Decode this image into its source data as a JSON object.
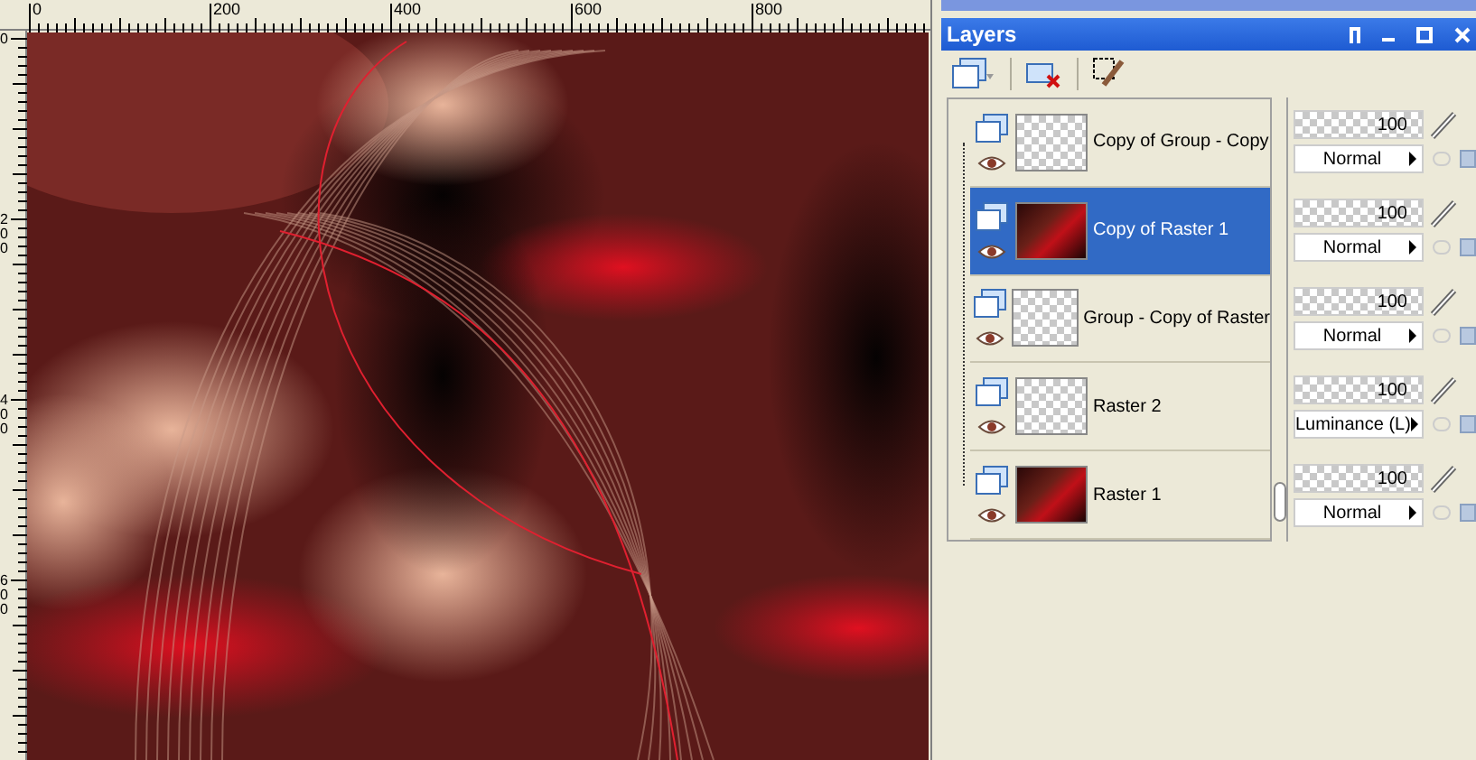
{
  "rulers": {
    "horizontal": [
      "0",
      "200",
      "400",
      "600",
      "800"
    ],
    "vertical": [
      "0",
      "200",
      "400",
      "600"
    ]
  },
  "layers_panel": {
    "title": "Layers",
    "layers": [
      {
        "name": "Copy of Group - Copy",
        "selected": false,
        "kind": "transparent",
        "opacity": "100",
        "level": 1,
        "blend_mode": "Normal"
      },
      {
        "name": "Copy of Raster 1",
        "selected": true,
        "kind": "dark",
        "opacity": "100",
        "level": 1,
        "blend_mode": "Normal"
      },
      {
        "name": "Group - Copy of Raster",
        "selected": false,
        "kind": "transparent",
        "opacity": "100",
        "level": 1,
        "blend_mode": "Normal"
      },
      {
        "name": "Raster 2",
        "selected": false,
        "kind": "transparent",
        "opacity": "100",
        "level": 1,
        "blend_mode": "Luminance (L)"
      },
      {
        "name": "Raster 1",
        "selected": false,
        "kind": "dark",
        "opacity": "100",
        "level": 1,
        "blend_mode": "Normal"
      }
    ]
  }
}
